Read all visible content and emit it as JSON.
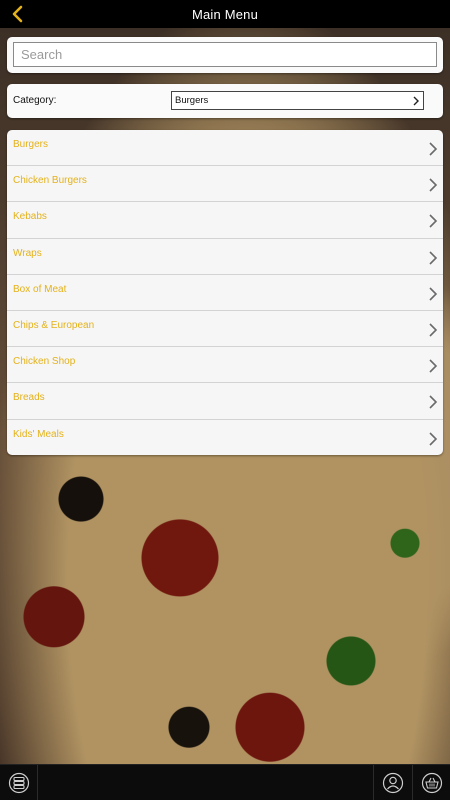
{
  "header": {
    "title": "Main Menu"
  },
  "search": {
    "placeholder": "Search",
    "value": ""
  },
  "category": {
    "label": "Category:",
    "selected": "Burgers"
  },
  "menu": {
    "items": [
      {
        "label": "Burgers"
      },
      {
        "label": "Chicken Burgers"
      },
      {
        "label": "Kebabs"
      },
      {
        "label": "Wraps"
      },
      {
        "label": "Box of Meat"
      },
      {
        "label": "Chips & European"
      },
      {
        "label": "Chicken Shop"
      },
      {
        "label": "Breads"
      },
      {
        "label": "Kids' Meals"
      }
    ]
  },
  "colors": {
    "accent": "#e4b21a",
    "header_bg": "#000000",
    "toolbar_bg": "#0c0c0c"
  },
  "icons": {
    "back": "chevron-left-icon",
    "menu": "stack-menu-icon",
    "user": "user-icon",
    "basket": "basket-icon"
  }
}
